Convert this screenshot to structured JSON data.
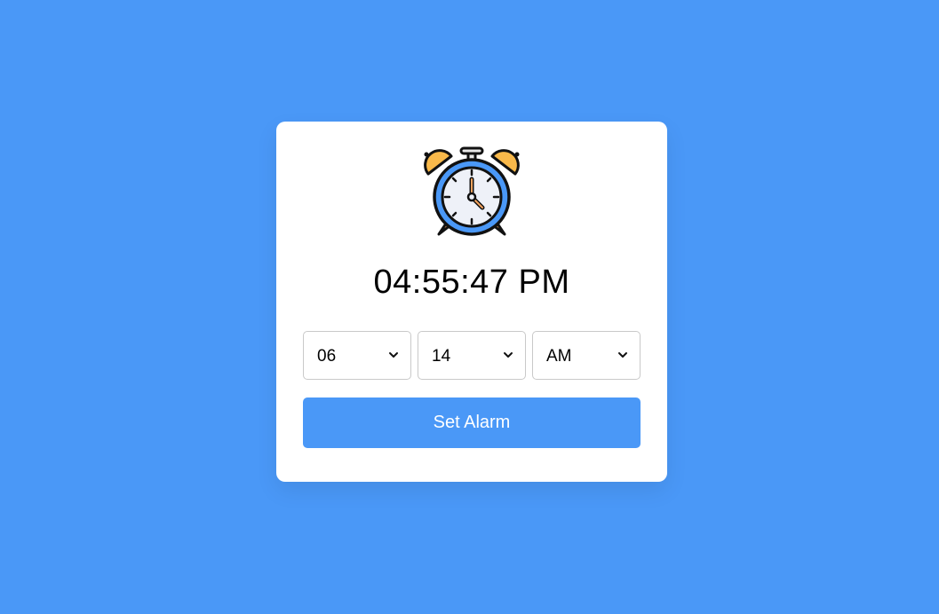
{
  "clock": {
    "current_time": "04:55:47 PM",
    "icon": "alarm-clock-icon"
  },
  "alarm": {
    "hour": "06",
    "minute": "14",
    "period": "AM",
    "set_label": "Set Alarm"
  },
  "colors": {
    "background": "#4a98f7",
    "card": "#ffffff",
    "button": "#4a98f7",
    "bell": "#f9b94a",
    "clock_ring": "#4a98f7"
  }
}
